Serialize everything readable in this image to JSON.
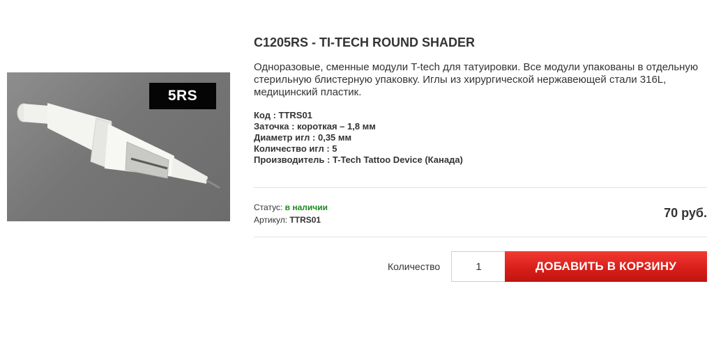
{
  "product": {
    "title": "C1205RS - TI-TECH ROUND SHADER",
    "description": "Одноразовые, сменные модули T-tech для татуировки. Все модули упакованы в отдельную стерильную блистерную упаковку. Иглы из хирургической нержавеющей стали 316L, медицинский пластик.",
    "image_badge": "5RS",
    "specs": [
      "Код : TTRS01",
      "Заточка : короткая – 1,8 мм",
      "Диаметр игл : 0,35 мм",
      "Количество игл : 5",
      "Производитель : T-Tech Tattoo Device (Канада)"
    ]
  },
  "status": {
    "status_label": "Статус: ",
    "status_value": "в наличии",
    "sku_label": "Артикул: ",
    "sku_value": "TTRS01"
  },
  "price": "70 руб.",
  "purchase": {
    "quantity_label": "Количество",
    "quantity_value": "1",
    "add_button_label": "ДОБАВИТЬ В КОРЗИНУ"
  },
  "colors": {
    "status_green": "#1d8a1d",
    "button_red": "#d91f1a",
    "text": "#333333"
  }
}
